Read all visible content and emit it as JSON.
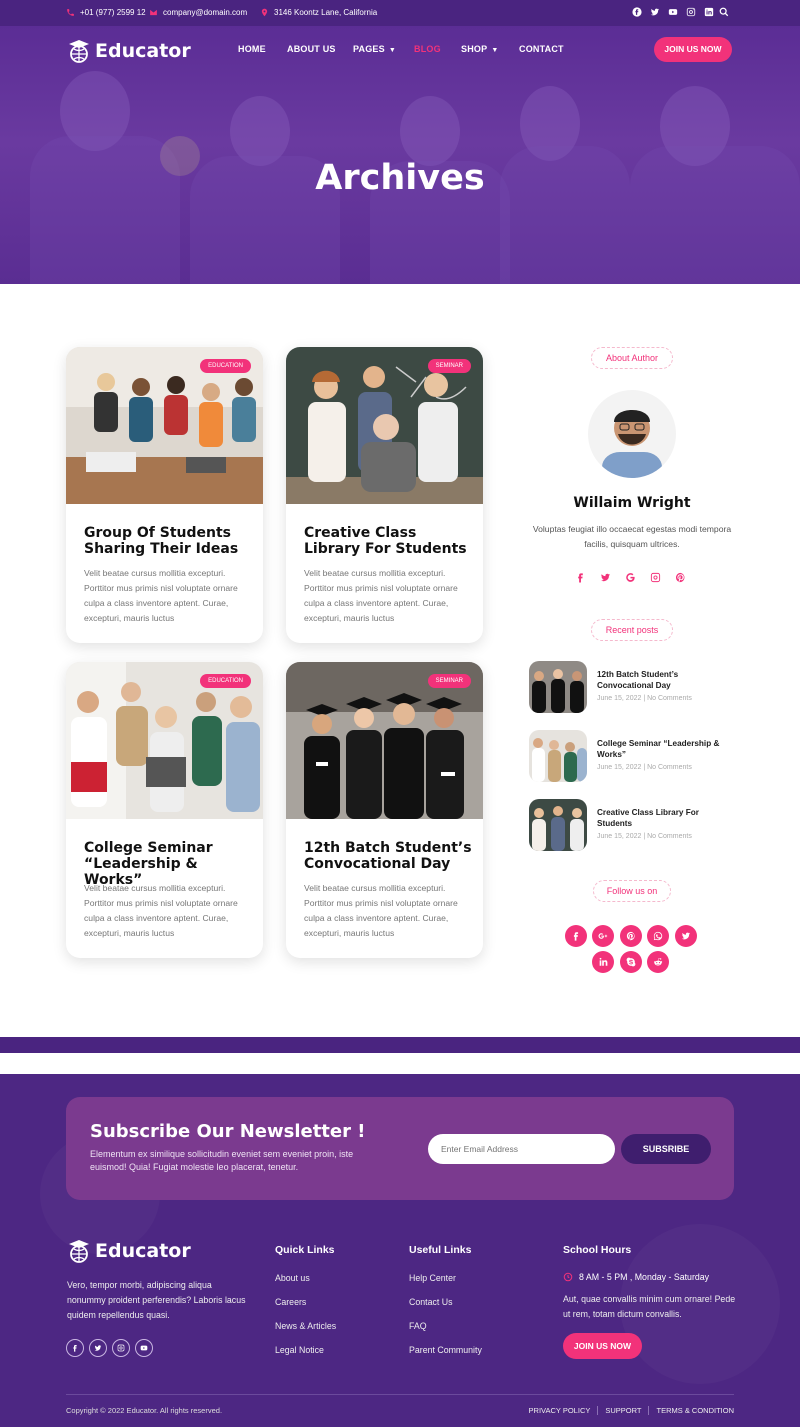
{
  "topbar": {
    "phone": "+01 (977) 2599 12",
    "email": "company@domain.com",
    "address": "3146 Koontz Lane, California",
    "social_icons": [
      "facebook-icon",
      "twitter-icon",
      "youtube-icon",
      "instagram-icon",
      "linkedin-icon"
    ],
    "search_icon": "search-icon"
  },
  "brand": {
    "logo_text": "Educator",
    "accent": "#f2327a",
    "primary": "#4d2783"
  },
  "nav": {
    "home": "HOME",
    "about": "ABOUT US",
    "pages": "PAGES",
    "blog": "BLOG",
    "shop": "SHOP",
    "contact": "CONTACT",
    "join": "JOIN US NOW"
  },
  "hero": {
    "title": "Archives"
  },
  "posts": [
    {
      "badge": "EDUCATION",
      "title": "Group Of Students Sharing Their Ideas",
      "excerpt": "Velit beatae cursus mollitia excepturi. Porttitor mus primis nisl voluptate ornare culpa a class inventore aptent. Curae, excepturi, mauris luctus"
    },
    {
      "badge": "SEMINAR",
      "title": "Creative Class Library For Students",
      "excerpt": "Velit beatae cursus mollitia excepturi. Porttitor mus primis nisl voluptate ornare culpa a class inventore aptent. Curae, excepturi, mauris luctus"
    },
    {
      "badge": "EDUCATION",
      "title": "College Seminar “Leadership & Works”",
      "excerpt": "Velit beatae cursus mollitia excepturi. Porttitor mus primis nisl voluptate ornare culpa a class inventore aptent. Curae, excepturi, mauris luctus"
    },
    {
      "badge": "SEMINAR",
      "title": "12th Batch Student’s Convocational Day",
      "excerpt": "Velit beatae cursus mollitia excepturi. Porttitor mus primis nisl voluptate ornare culpa a class inventore aptent. Curae, excepturi, mauris luctus"
    }
  ],
  "sidebar": {
    "about_label": "About Author",
    "author_name": "Willaim Wright",
    "author_bio": "Voluptas feugiat illo occaecat egestas modi tempora facilis, quisquam ultrices.",
    "author_social": [
      "facebook-icon",
      "twitter-icon",
      "google-icon",
      "instagram-icon",
      "pinterest-icon"
    ],
    "recent_label": "Recent posts",
    "recent": [
      {
        "title": "12th Batch Student’s Convocational Day",
        "date": "June 15, 2022 | No Comments"
      },
      {
        "title": "College Seminar “Leadership & Works”",
        "date": "June 15, 2022 | No Comments"
      },
      {
        "title": "Creative Class Library For Students",
        "date": "June 15, 2022 | No Comments"
      }
    ],
    "follow_label": "Follow us on",
    "follow_icons": [
      "facebook-icon",
      "google-plus-icon",
      "pinterest-icon",
      "whatsapp-icon",
      "twitter-icon",
      "linkedin-icon",
      "skype-icon",
      "reddit-icon"
    ]
  },
  "newsletter": {
    "title": "Subscribe Our Newsletter !",
    "text": "Elementum ex similique sollicitudin eveniet sem eveniet proin, iste euismod! Quia! Fugiat molestie leo placerat, tenetur.",
    "placeholder": "Enter Email Address",
    "button": "SUBSRIBE"
  },
  "footer": {
    "logo_text": "Educator",
    "about": "Vero, tempor morbi, adipiscing aliqua nonummy proident perferendis? Laboris lacus quidem repellendus quasi.",
    "social_icons": [
      "facebook-icon",
      "twitter-icon",
      "instagram-icon",
      "youtube-icon"
    ],
    "quick_title": "Quick Links",
    "quick": [
      "About us",
      "Careers",
      "News & Articles",
      "Legal Notice"
    ],
    "useful_title": "Useful Links",
    "useful": [
      "Help Center",
      "Contact Us",
      "FAQ",
      "Parent Community"
    ],
    "hours_title": "School Hours",
    "hours": "8 AM - 5 PM , Monday - Saturday",
    "hours_text": "Aut, quae convallis minim cum ornare! Pede ut rem, totam dictum convallis.",
    "join": "JOIN US NOW",
    "copyright": "Copyright © 2022 Educator. All rights reserved.",
    "bottom_links": [
      "PRIVACY POLICY",
      "SUPPORT",
      "TERMS & CONDITION"
    ]
  }
}
